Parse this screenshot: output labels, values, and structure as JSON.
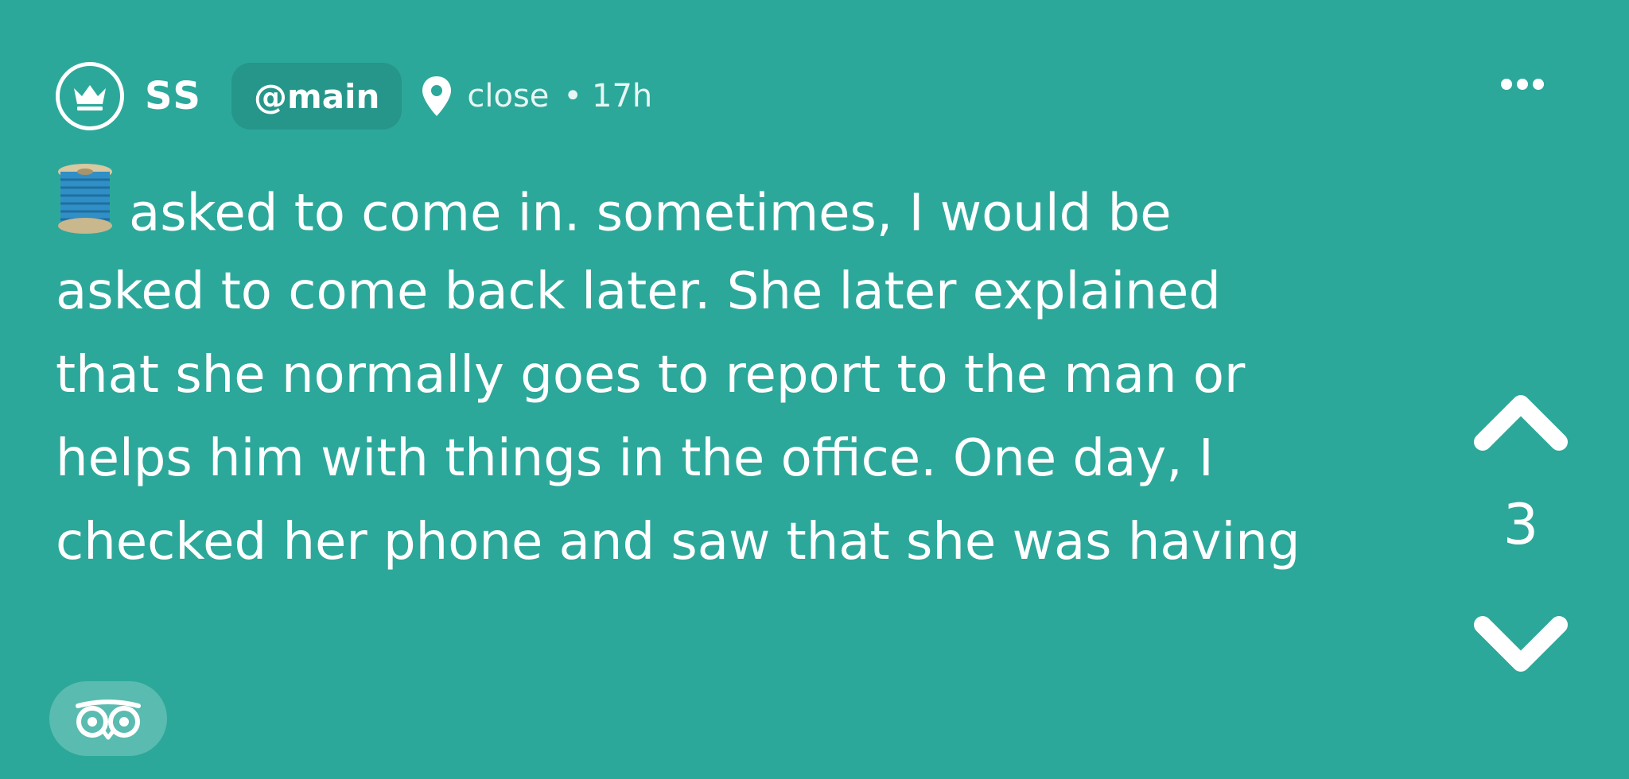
{
  "post": {
    "author": "SS",
    "channel": "@main",
    "location": "close",
    "separator": "•",
    "age": "17h",
    "body_lines": [
      "asked to come in. sometimes, I would be",
      "asked to come back later. She later explained",
      "that she normally goes to report to the man or",
      "helps him with things in the office. One day, I",
      "checked her phone and saw that she was having"
    ],
    "score": "3"
  },
  "icons": {
    "avatar": "crown-icon",
    "location": "map-pin-icon",
    "more": "more-dots-icon",
    "leading_emoji": "thread-spool-icon",
    "upvote": "chevron-up-icon",
    "downvote": "chevron-down-icon",
    "reaction": "owl-eyes-icon"
  },
  "colors": {
    "background": "#2ca89a",
    "chip": "#26968a",
    "text": "#ffffff"
  }
}
